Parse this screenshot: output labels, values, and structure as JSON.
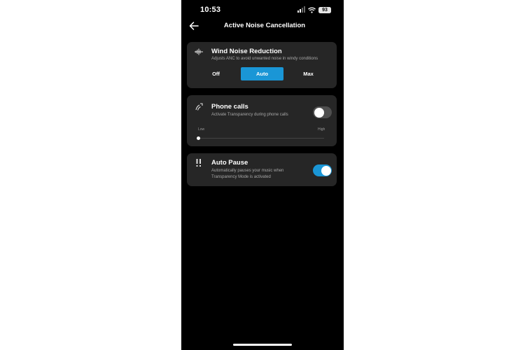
{
  "status_bar": {
    "time": "10:53",
    "battery": "93",
    "icons": [
      "signal-icon",
      "wifi-icon",
      "battery-icon"
    ]
  },
  "nav": {
    "title": "Active Noise Cancellation",
    "back_icon": "back-arrow-icon"
  },
  "wind_noise": {
    "title": "Wind Noise Reduction",
    "description": "Adjusts ANC to avoid unwanted noise in windy conditions",
    "options": [
      "Off",
      "Auto",
      "Max"
    ],
    "selected": "Auto",
    "icon": "wind-icon"
  },
  "phone_calls": {
    "title": "Phone calls",
    "description": "Activate Transparency during phone calls",
    "toggle_on": false,
    "slider_low_label": "Low",
    "slider_high_label": "High",
    "slider_value": 0,
    "icon": "phone-transparency-icon"
  },
  "auto_pause": {
    "title": "Auto Pause",
    "description_line1": "Automatically pauses your music when",
    "description_line2": "Transparency Mode is activated",
    "toggle_on": true,
    "icon": "pause-alert-icon"
  },
  "colors": {
    "accent": "#1a96d6",
    "card": "#262626",
    "background": "#000000"
  }
}
